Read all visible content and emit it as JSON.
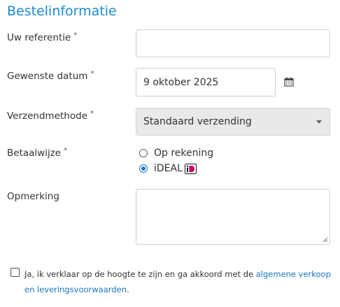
{
  "form": {
    "title": "Bestelinformatie",
    "required_mark": "*",
    "reference": {
      "label": "Uw referentie",
      "value": ""
    },
    "date": {
      "label": "Gewenste datum",
      "value": "9 oktober 2025"
    },
    "shipping": {
      "label": "Verzendmethode",
      "selected": "Standaard verzending"
    },
    "payment": {
      "label": "Betaalwijze",
      "options": [
        {
          "label": "Op rekening",
          "checked": false
        },
        {
          "label": "iDEAL",
          "checked": true
        }
      ]
    },
    "remark": {
      "label": "Opmerking",
      "value": ""
    },
    "consent": {
      "checked": false,
      "text_before": "Ja, ik verklaar op de hoogte te zijn en ga akkoord met de ",
      "link_text": "algemene verkoop en leveringsvoorwaarden",
      "text_after": "."
    }
  },
  "colors": {
    "title": "#1a8ad4",
    "link": "#1a75c9",
    "ideal_brand": "#cc0066"
  },
  "icons": {
    "date": "calendar-icon",
    "shipping": "caret-down-icon",
    "ideal": "ideal-logo-icon"
  }
}
